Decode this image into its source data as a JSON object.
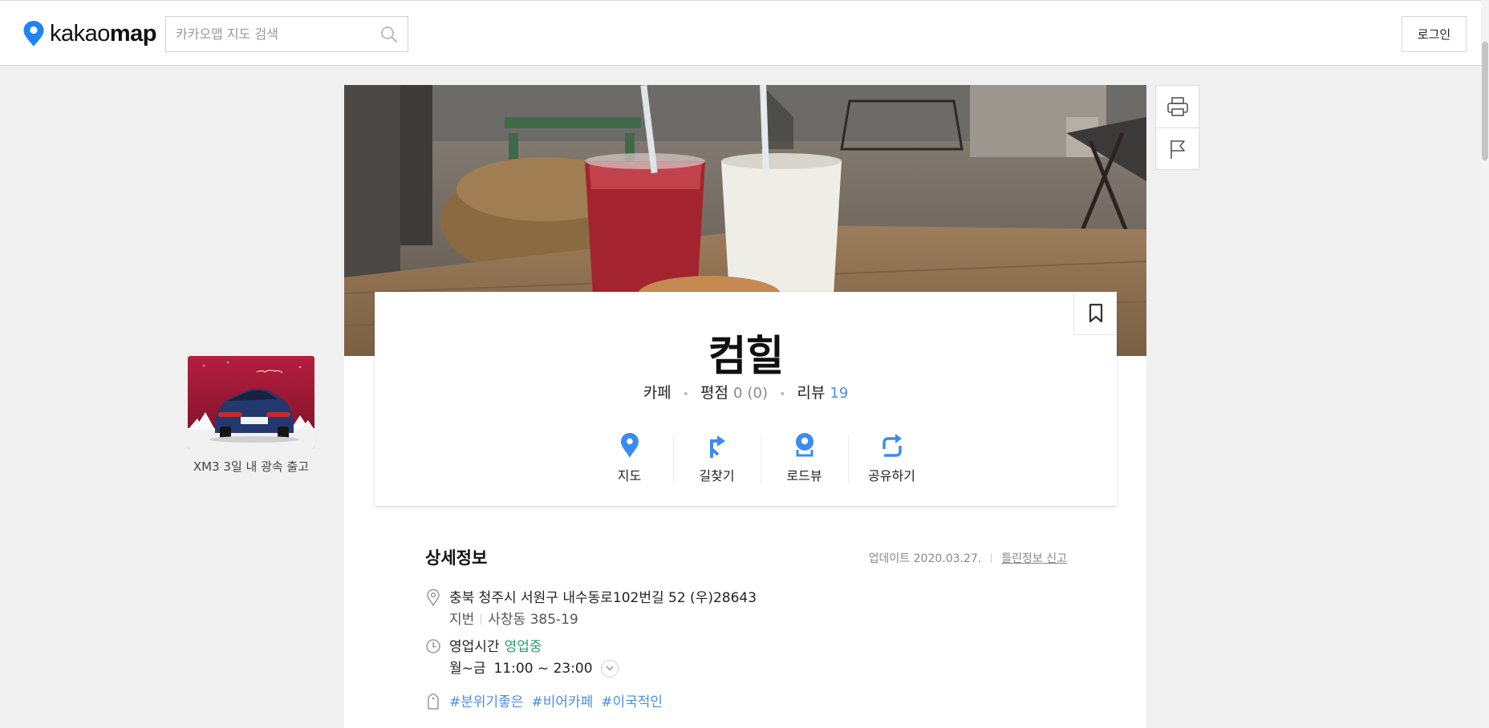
{
  "header": {
    "logo": {
      "text_light": "kakao",
      "text_bold": "map"
    },
    "search": {
      "placeholder": "카카오맵 지도 검색",
      "value": "",
      "icon": "search-icon"
    },
    "login_label": "로그인"
  },
  "ad": {
    "text": "XM3 3일 내 광속 출고"
  },
  "side_tools": [
    {
      "name": "print",
      "icon": "printer-icon"
    },
    {
      "name": "report",
      "icon": "flag-icon"
    }
  ],
  "place": {
    "name": "컴힐",
    "category": "카페",
    "rating_label": "평점",
    "rating_value": "0",
    "rating_count": "(0)",
    "review_label": "리뷰",
    "review_count": "19",
    "bookmark_icon": "bookmark-icon"
  },
  "actions": [
    {
      "label": "지도",
      "icon": "map-pin-icon"
    },
    {
      "label": "길찾기",
      "icon": "directions-icon"
    },
    {
      "label": "로드뷰",
      "icon": "roadview-icon"
    },
    {
      "label": "공유하기",
      "icon": "share-icon"
    }
  ],
  "detail": {
    "title": "상세정보",
    "updated": "업데이트 2020.03.27.",
    "report_label": "틀린정보 신고",
    "address": "충북 청주시 서원구 내수동로102번길 52 (우)28643",
    "jibun_label": "지번",
    "jibun_value": "사창동 385-19",
    "hours_label": "영업시간",
    "hours_status": "영업중",
    "hours_days": "월~금",
    "hours_time": "11:00 ~ 23:00",
    "tags": [
      "#분위기좋은",
      "#비어카페",
      "#이국적인"
    ]
  },
  "colors": {
    "accent_blue": "#4a8ee8",
    "open_green": "#2aa06f",
    "icon_blue": "#3c8cf0",
    "page_bg": "#f0f0f0"
  }
}
